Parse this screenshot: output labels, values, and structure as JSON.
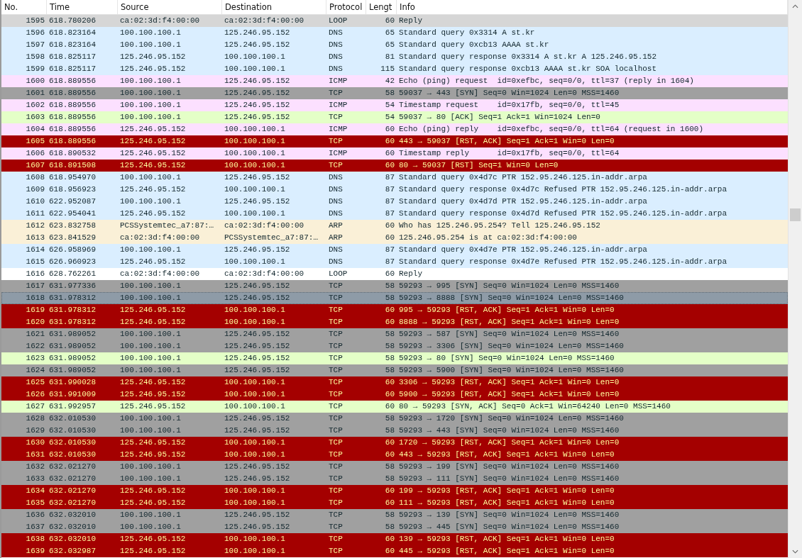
{
  "table": {
    "columns": [
      "No.",
      "Time",
      "Source",
      "Destination",
      "Protocol",
      "Lengt",
      "Info"
    ],
    "rows": [
      {
        "no": "1595",
        "time": "618.780206",
        "source": "ca:02:3d:f4:00:00",
        "destination": "ca:02:3d:f4:00:00",
        "protocol": "LOOP",
        "length": "60",
        "info": "Reply",
        "color": "#d6d6d6",
        "selected": false
      },
      {
        "no": "1596",
        "time": "618.823164",
        "source": "100.100.100.1",
        "destination": "125.246.95.152",
        "protocol": "DNS",
        "length": "65",
        "info": "Standard query 0x3314 A st.kr",
        "color": "#daeeff",
        "selected": false
      },
      {
        "no": "1597",
        "time": "618.823164",
        "source": "100.100.100.1",
        "destination": "125.246.95.152",
        "protocol": "DNS",
        "length": "65",
        "info": "Standard query 0xcb13 AAAA st.kr",
        "color": "#daeeff",
        "selected": false
      },
      {
        "no": "1598",
        "time": "618.825117",
        "source": "125.246.95.152",
        "destination": "100.100.100.1",
        "protocol": "DNS",
        "length": "81",
        "info": "Standard query response 0x3314 A st.kr A 125.246.95.152",
        "color": "#daeeff",
        "selected": false
      },
      {
        "no": "1599",
        "time": "618.825117",
        "source": "125.246.95.152",
        "destination": "100.100.100.1",
        "protocol": "DNS",
        "length": "115",
        "info": "Standard query response 0xcb13 AAAA st.kr SOA localhost",
        "color": "#daeeff",
        "selected": false
      },
      {
        "no": "1600",
        "time": "618.889556",
        "source": "100.100.100.1",
        "destination": "125.246.95.152",
        "protocol": "ICMP",
        "length": "42",
        "info": "Echo (ping) request  id=0xefbc, seq=0/0, ttl=37 (reply in 1604)",
        "color": "#fce0ff",
        "selected": false
      },
      {
        "no": "1601",
        "time": "618.889556",
        "source": "100.100.100.1",
        "destination": "125.246.95.152",
        "protocol": "TCP",
        "length": "58",
        "info": "59037 → 443 [SYN] Seq=0 Win=1024 Len=0 MSS=1460",
        "color": "#a0a0a0",
        "selected": false
      },
      {
        "no": "1602",
        "time": "618.889556",
        "source": "100.100.100.1",
        "destination": "125.246.95.152",
        "protocol": "ICMP",
        "length": "54",
        "info": "Timestamp request    id=0x17fb, seq=0/0, ttl=45",
        "color": "#fce0ff",
        "selected": false
      },
      {
        "no": "1603",
        "time": "618.889556",
        "source": "100.100.100.1",
        "destination": "125.246.95.152",
        "protocol": "TCP",
        "length": "54",
        "info": "59037 → 80 [ACK] Seq=1 Ack=1 Win=1024 Len=0",
        "color": "#e4ffc7",
        "selected": false
      },
      {
        "no": "1604",
        "time": "618.889556",
        "source": "125.246.95.152",
        "destination": "100.100.100.1",
        "protocol": "ICMP",
        "length": "60",
        "info": "Echo (ping) reply    id=0xefbc, seq=0/0, ttl=64 (request in 1600)",
        "color": "#fce0ff",
        "selected": false
      },
      {
        "no": "1605",
        "time": "618.889556",
        "source": "125.246.95.152",
        "destination": "100.100.100.1",
        "protocol": "TCP",
        "length": "60",
        "info": "443 → 59037 [RST, ACK] Seq=1 Ack=1 Win=0 Len=0",
        "color": "#a40000",
        "selected": false
      },
      {
        "no": "1606",
        "time": "618.890532",
        "source": "125.246.95.152",
        "destination": "100.100.100.1",
        "protocol": "ICMP",
        "length": "60",
        "info": "Timestamp reply      id=0x17fb, seq=0/0, ttl=64",
        "color": "#fce0ff",
        "selected": false
      },
      {
        "no": "1607",
        "time": "618.891508",
        "source": "125.246.95.152",
        "destination": "100.100.100.1",
        "protocol": "TCP",
        "length": "60",
        "info": "80 → 59037 [RST] Seq=1 Win=0 Len=0",
        "color": "#a40000",
        "selected": false
      },
      {
        "no": "1608",
        "time": "618.954970",
        "source": "100.100.100.1",
        "destination": "125.246.95.152",
        "protocol": "DNS",
        "length": "87",
        "info": "Standard query 0x4d7c PTR 152.95.246.125.in-addr.arpa",
        "color": "#daeeff",
        "selected": false
      },
      {
        "no": "1609",
        "time": "618.956923",
        "source": "125.246.95.152",
        "destination": "100.100.100.1",
        "protocol": "DNS",
        "length": "87",
        "info": "Standard query response 0x4d7c Refused PTR 152.95.246.125.in-addr.arpa",
        "color": "#daeeff",
        "selected": false
      },
      {
        "no": "1610",
        "time": "622.952087",
        "source": "100.100.100.1",
        "destination": "125.246.95.152",
        "protocol": "DNS",
        "length": "87",
        "info": "Standard query 0x4d7d PTR 152.95.246.125.in-addr.arpa",
        "color": "#daeeff",
        "selected": false
      },
      {
        "no": "1611",
        "time": "622.954041",
        "source": "125.246.95.152",
        "destination": "100.100.100.1",
        "protocol": "DNS",
        "length": "87",
        "info": "Standard query response 0x4d7d Refused PTR 152.95.246.125.in-addr.arpa",
        "color": "#daeeff",
        "selected": false
      },
      {
        "no": "1612",
        "time": "623.832758",
        "source": "PCSSystemtec_a7:87:…",
        "destination": "ca:02:3d:f4:00:00",
        "protocol": "ARP",
        "length": "60",
        "info": "Who has 125.246.95.254? Tell 125.246.95.152",
        "color": "#faf0d7",
        "selected": false
      },
      {
        "no": "1613",
        "time": "623.841529",
        "source": "ca:02:3d:f4:00:00",
        "destination": "PCSSystemtec_a7:87:…",
        "protocol": "ARP",
        "length": "60",
        "info": "125.246.95.254 is at ca:02:3d:f4:00:00",
        "color": "#faf0d7",
        "selected": false
      },
      {
        "no": "1614",
        "time": "626.958969",
        "source": "100.100.100.1",
        "destination": "125.246.95.152",
        "protocol": "DNS",
        "length": "87",
        "info": "Standard query 0x4d7e PTR 152.95.246.125.in-addr.arpa",
        "color": "#daeeff",
        "selected": false
      },
      {
        "no": "1615",
        "time": "626.960923",
        "source": "125.246.95.152",
        "destination": "100.100.100.1",
        "protocol": "DNS",
        "length": "87",
        "info": "Standard query response 0x4d7e Refused PTR 152.95.246.125.in-addr.arpa",
        "color": "#daeeff",
        "selected": false
      },
      {
        "no": "1616",
        "time": "628.762261",
        "source": "ca:02:3d:f4:00:00",
        "destination": "ca:02:3d:f4:00:00",
        "protocol": "LOOP",
        "length": "60",
        "info": "Reply",
        "color": "#ffffff",
        "selected": false
      },
      {
        "no": "1617",
        "time": "631.977336",
        "source": "100.100.100.1",
        "destination": "125.246.95.152",
        "protocol": "TCP",
        "length": "58",
        "info": "59293 → 995 [SYN] Seq=0 Win=1024 Len=0 MSS=1460",
        "color": "#a0a0a0",
        "selected": false
      },
      {
        "no": "1618",
        "time": "631.978312",
        "source": "100.100.100.1",
        "destination": "125.246.95.152",
        "protocol": "TCP",
        "length": "58",
        "info": "59293 → 8888 [SYN] Seq=0 Win=1024 Len=0 MSS=1460",
        "color": "#8e9ba7",
        "selected": true
      },
      {
        "no": "1619",
        "time": "631.978312",
        "source": "125.246.95.152",
        "destination": "100.100.100.1",
        "protocol": "TCP",
        "length": "60",
        "info": "995 → 59293 [RST, ACK] Seq=1 Ack=1 Win=0 Len=0",
        "color": "#a40000",
        "selected": false
      },
      {
        "no": "1620",
        "time": "631.978312",
        "source": "125.246.95.152",
        "destination": "100.100.100.1",
        "protocol": "TCP",
        "length": "60",
        "info": "8888 → 59293 [RST, ACK] Seq=1 Ack=1 Win=0 Len=0",
        "color": "#a40000",
        "selected": false
      },
      {
        "no": "1621",
        "time": "631.989052",
        "source": "100.100.100.1",
        "destination": "125.246.95.152",
        "protocol": "TCP",
        "length": "58",
        "info": "59293 → 587 [SYN] Seq=0 Win=1024 Len=0 MSS=1460",
        "color": "#a0a0a0",
        "selected": false
      },
      {
        "no": "1622",
        "time": "631.989052",
        "source": "100.100.100.1",
        "destination": "125.246.95.152",
        "protocol": "TCP",
        "length": "58",
        "info": "59293 → 3306 [SYN] Seq=0 Win=1024 Len=0 MSS=1460",
        "color": "#a0a0a0",
        "selected": false
      },
      {
        "no": "1623",
        "time": "631.989052",
        "source": "100.100.100.1",
        "destination": "125.246.95.152",
        "protocol": "TCP",
        "length": "58",
        "info": "59293 → 80 [SYN] Seq=0 Win=1024 Len=0 MSS=1460",
        "color": "#e4ffc7",
        "selected": false
      },
      {
        "no": "1624",
        "time": "631.989052",
        "source": "100.100.100.1",
        "destination": "125.246.95.152",
        "protocol": "TCP",
        "length": "58",
        "info": "59293 → 5900 [SYN] Seq=0 Win=1024 Len=0 MSS=1460",
        "color": "#a0a0a0",
        "selected": false
      },
      {
        "no": "1625",
        "time": "631.990028",
        "source": "125.246.95.152",
        "destination": "100.100.100.1",
        "protocol": "TCP",
        "length": "60",
        "info": "3306 → 59293 [RST, ACK] Seq=1 Ack=1 Win=0 Len=0",
        "color": "#a40000",
        "selected": false
      },
      {
        "no": "1626",
        "time": "631.991009",
        "source": "125.246.95.152",
        "destination": "100.100.100.1",
        "protocol": "TCP",
        "length": "60",
        "info": "5900 → 59293 [RST, ACK] Seq=1 Ack=1 Win=0 Len=0",
        "color": "#a40000",
        "selected": false
      },
      {
        "no": "1627",
        "time": "631.992957",
        "source": "125.246.95.152",
        "destination": "100.100.100.1",
        "protocol": "TCP",
        "length": "60",
        "info": "80 → 59293 [SYN, ACK] Seq=0 Ack=1 Win=64240 Len=0 MSS=1460",
        "color": "#e4ffc7",
        "selected": false
      },
      {
        "no": "1628",
        "time": "632.010530",
        "source": "100.100.100.1",
        "destination": "125.246.95.152",
        "protocol": "TCP",
        "length": "58",
        "info": "59293 → 1720 [SYN] Seq=0 Win=1024 Len=0 MSS=1460",
        "color": "#a0a0a0",
        "selected": false
      },
      {
        "no": "1629",
        "time": "632.010530",
        "source": "100.100.100.1",
        "destination": "125.246.95.152",
        "protocol": "TCP",
        "length": "58",
        "info": "59293 → 443 [SYN] Seq=0 Win=1024 Len=0 MSS=1460",
        "color": "#a0a0a0",
        "selected": false
      },
      {
        "no": "1630",
        "time": "632.010530",
        "source": "125.246.95.152",
        "destination": "100.100.100.1",
        "protocol": "TCP",
        "length": "60",
        "info": "1720 → 59293 [RST, ACK] Seq=1 Ack=1 Win=0 Len=0",
        "color": "#a40000",
        "selected": false
      },
      {
        "no": "1631",
        "time": "632.010530",
        "source": "125.246.95.152",
        "destination": "100.100.100.1",
        "protocol": "TCP",
        "length": "60",
        "info": "443 → 59293 [RST, ACK] Seq=1 Ack=1 Win=0 Len=0",
        "color": "#a40000",
        "selected": false
      },
      {
        "no": "1632",
        "time": "632.021270",
        "source": "100.100.100.1",
        "destination": "125.246.95.152",
        "protocol": "TCP",
        "length": "58",
        "info": "59293 → 199 [SYN] Seq=0 Win=1024 Len=0 MSS=1460",
        "color": "#a0a0a0",
        "selected": false
      },
      {
        "no": "1633",
        "time": "632.021270",
        "source": "100.100.100.1",
        "destination": "125.246.95.152",
        "protocol": "TCP",
        "length": "58",
        "info": "59293 → 111 [SYN] Seq=0 Win=1024 Len=0 MSS=1460",
        "color": "#a0a0a0",
        "selected": false
      },
      {
        "no": "1634",
        "time": "632.021270",
        "source": "125.246.95.152",
        "destination": "100.100.100.1",
        "protocol": "TCP",
        "length": "60",
        "info": "199 → 59293 [RST, ACK] Seq=1 Ack=1 Win=0 Len=0",
        "color": "#a40000",
        "selected": false
      },
      {
        "no": "1635",
        "time": "632.021270",
        "source": "125.246.95.152",
        "destination": "100.100.100.1",
        "protocol": "TCP",
        "length": "60",
        "info": "111 → 59293 [RST, ACK] Seq=1 Ack=1 Win=0 Len=0",
        "color": "#a40000",
        "selected": false
      },
      {
        "no": "1636",
        "time": "632.032010",
        "source": "100.100.100.1",
        "destination": "125.246.95.152",
        "protocol": "TCP",
        "length": "58",
        "info": "59293 → 139 [SYN] Seq=0 Win=1024 Len=0 MSS=1460",
        "color": "#a0a0a0",
        "selected": false
      },
      {
        "no": "1637",
        "time": "632.032010",
        "source": "100.100.100.1",
        "destination": "125.246.95.152",
        "protocol": "TCP",
        "length": "58",
        "info": "59293 → 445 [SYN] Seq=0 Win=1024 Len=0 MSS=1460",
        "color": "#a0a0a0",
        "selected": false
      },
      {
        "no": "1638",
        "time": "632.032010",
        "source": "125.246.95.152",
        "destination": "100.100.100.1",
        "protocol": "TCP",
        "length": "60",
        "info": "139 → 59293 [RST, ACK] Seq=1 Ack=1 Win=0 Len=0",
        "color": "#a40000",
        "selected": false
      },
      {
        "no": "1639",
        "time": "632.032987",
        "source": "125.246.95.152",
        "destination": "100.100.100.1",
        "protocol": "TCP",
        "length": "60",
        "info": "445 → 59293 [RST, ACK] Seq=1 Ack=1 Win=0 Len=0",
        "color": "#a40000",
        "selected": false
      }
    ]
  }
}
